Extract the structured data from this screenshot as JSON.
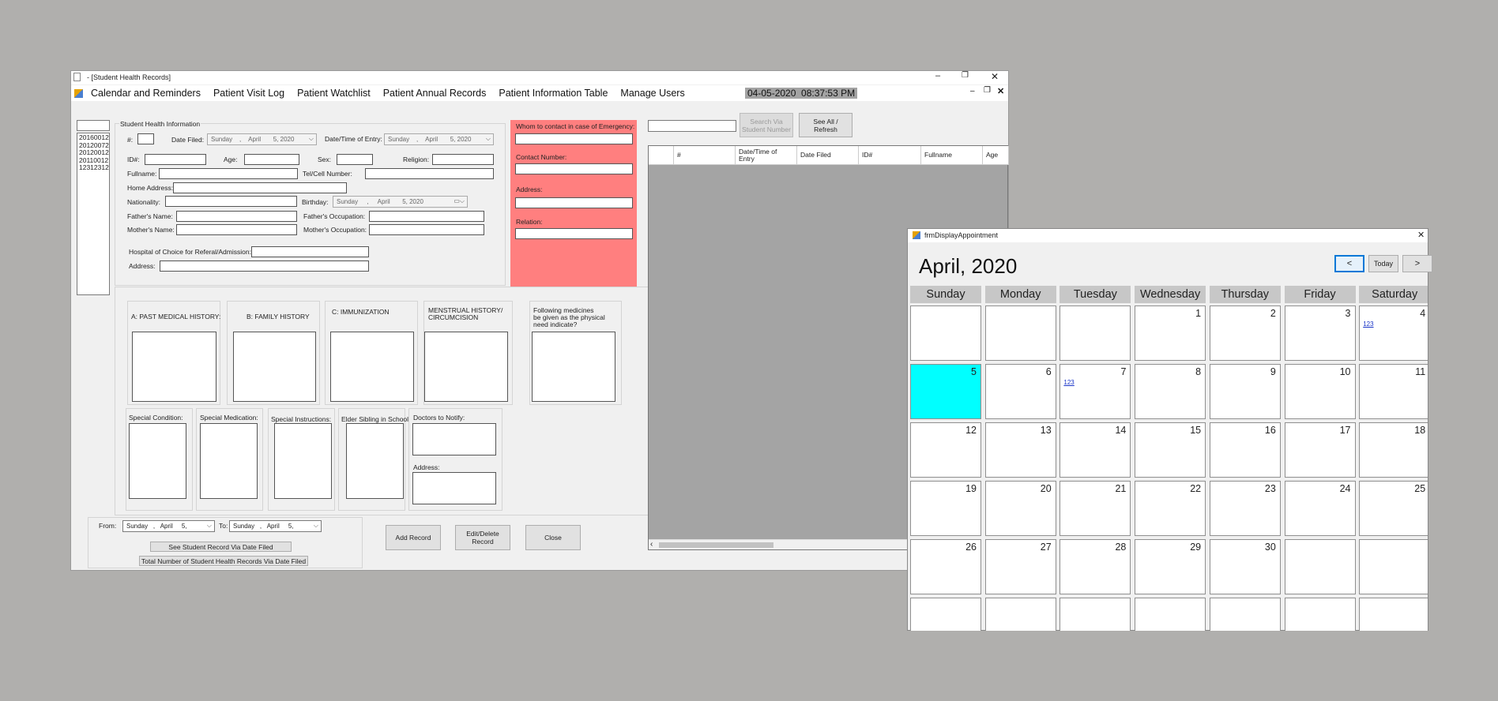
{
  "main_window": {
    "title": "- [Student Health Records]",
    "menu": [
      "Calendar and Reminders",
      "Patient Visit Log",
      "Patient Watchlist",
      "Patient Annual Records",
      "Patient Information Table",
      "Manage Users"
    ],
    "clock": "04-05-2020  08:37:53 PM"
  },
  "id_list": [
    "20160012:",
    "20120072:",
    "20120012:",
    "20110012:",
    "12312312:"
  ],
  "student_info": {
    "group_label": "Student Health Information",
    "hash_label": "#:",
    "date_filed_label": "Date Filed:",
    "date_filed": {
      "day": "Sunday",
      "sep1": ",",
      "month": "April",
      "date": "5, 2020"
    },
    "entry_label": "Date/Time of Entry:",
    "entry_date": {
      "day": "Sunday",
      "sep1": ",",
      "month": "April",
      "date": "5, 2020"
    },
    "id_label": "ID#:",
    "age_label": "Age:",
    "sex_label": "Sex:",
    "religion_label": "Religion:",
    "fullname_label": "Fullname:",
    "tel_label": "Tel/Cell Number:",
    "home_address_label": "Home Address:",
    "nationality_label": "Nationality:",
    "birthday_label": "Birthday:",
    "birthday": {
      "day": "Sunday",
      "sep1": ",",
      "month": "April",
      "date": "5, 2020"
    },
    "father_name_label": "Father's Name:",
    "father_occ_label": "Father's Occupation:",
    "mother_name_label": "Mother's Name:",
    "mother_occ_label": "Mother's Occupation:",
    "hospital_label": "Hospital of Choice for Referal/Admission:",
    "address_label": "Address:"
  },
  "emergency": {
    "contact_label": "Whom to contact in case of Emergency:",
    "number_label": "Contact Number:",
    "address_label": "Address:",
    "relation_label": "Relation:",
    "color": "#ff7f7f"
  },
  "history": {
    "past_medical": "A: PAST MEDICAL HISTORY:",
    "family": "B: FAMILY HISTORY",
    "immunization": "C: IMMUNIZATION",
    "menstrual_1": "MENSTRUAL HISTORY/",
    "menstrual_2": "CIRCUMCISION",
    "medicines_1": "Following medicines",
    "medicines_2": "be given as the physical",
    "medicines_3": "need indicate?"
  },
  "special": {
    "condition": "Special Condition:",
    "medication": "Special Medication:",
    "instructions": "Special Instructions:",
    "sibling": "Elder Sibling in School",
    "doctors": "Doctors to Notify:",
    "address": "Address:"
  },
  "date_filter": {
    "from_label": "From:",
    "from": {
      "day": "Sunday",
      "sep1": ",",
      "month": "April",
      "date": "5,"
    },
    "to_label": "To:",
    "to": {
      "day": "Sunday",
      "sep1": ",",
      "month": "April",
      "date": "5,"
    },
    "see_btn": "See Student Record Via Date Filed",
    "total_btn": "Total Number of Student Health Records Via Date Filed"
  },
  "actions": {
    "add": "Add Record",
    "edit_1": "Edit/Delete",
    "edit_2": "Record",
    "close": "Close"
  },
  "search": {
    "search_1": "Search Via",
    "search_2": "Student Number",
    "see_1": "See All /",
    "see_2": "Refresh"
  },
  "grid": {
    "columns": [
      "#",
      "Date/Time of Entry",
      "Date Filed",
      "ID#",
      "Fullname",
      "Age"
    ]
  },
  "calendar": {
    "window_title": "frmDisplayAppointment",
    "month_title": "April, 2020",
    "prev": "<",
    "today": "Today",
    "next": ">",
    "days": [
      "Sunday",
      "Monday",
      "Tuesday",
      "Wednesday",
      "Thursday",
      "Friday",
      "Saturday"
    ],
    "weeks": [
      [
        {
          "n": ""
        },
        {
          "n": ""
        },
        {
          "n": ""
        },
        {
          "n": "1"
        },
        {
          "n": "2"
        },
        {
          "n": "3"
        },
        {
          "n": "4",
          "appt": "123"
        }
      ],
      [
        {
          "n": "5",
          "today": true
        },
        {
          "n": "6"
        },
        {
          "n": "7",
          "appt": "123"
        },
        {
          "n": "8"
        },
        {
          "n": "9"
        },
        {
          "n": "10"
        },
        {
          "n": "11"
        }
      ],
      [
        {
          "n": "12"
        },
        {
          "n": "13"
        },
        {
          "n": "14"
        },
        {
          "n": "15"
        },
        {
          "n": "16"
        },
        {
          "n": "17"
        },
        {
          "n": "18"
        }
      ],
      [
        {
          "n": "19"
        },
        {
          "n": "20"
        },
        {
          "n": "21"
        },
        {
          "n": "22"
        },
        {
          "n": "23"
        },
        {
          "n": "24"
        },
        {
          "n": "25"
        }
      ],
      [
        {
          "n": "26"
        },
        {
          "n": "27"
        },
        {
          "n": "28"
        },
        {
          "n": "29"
        },
        {
          "n": "30"
        },
        {
          "n": ""
        },
        {
          "n": ""
        }
      ],
      [
        {
          "n": ""
        },
        {
          "n": ""
        },
        {
          "n": ""
        },
        {
          "n": ""
        },
        {
          "n": ""
        },
        {
          "n": ""
        },
        {
          "n": ""
        }
      ]
    ],
    "today_color": "#00ffff"
  }
}
